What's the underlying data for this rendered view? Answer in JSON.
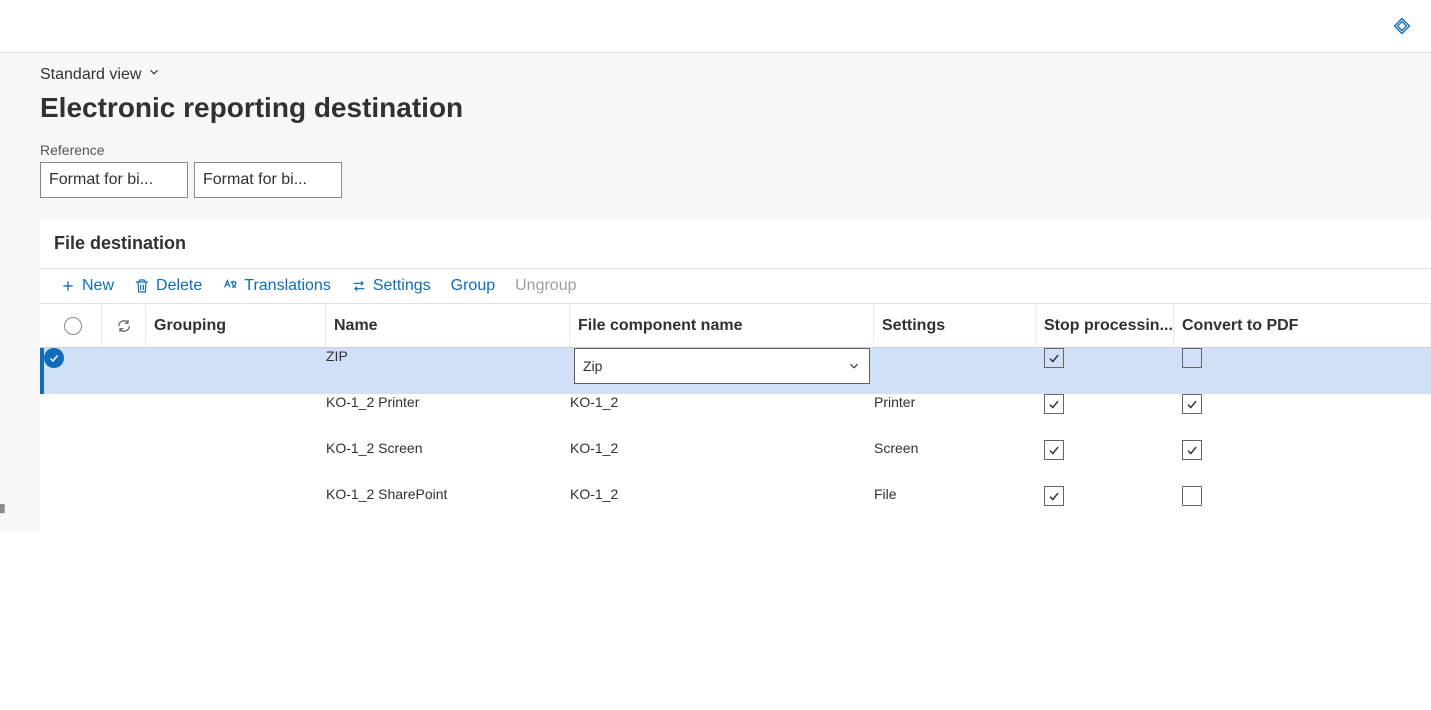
{
  "topbar": {},
  "header": {
    "view_label": "Standard view",
    "page_title": "Electronic reporting destination",
    "reference_label": "Reference",
    "reference_value": "Format for bi...",
    "reference_value2": "Format for bi..."
  },
  "section": {
    "title": "File destination",
    "toolbar": {
      "new": "New",
      "delete": "Delete",
      "translations": "Translations",
      "settings": "Settings",
      "group": "Group",
      "ungroup": "Ungroup"
    }
  },
  "grid": {
    "columns": {
      "grouping": "Grouping",
      "name": "Name",
      "file_component": "File component name",
      "settings": "Settings",
      "stop": "Stop processin...",
      "convert": "Convert to PDF"
    },
    "rows": [
      {
        "selected": true,
        "grouping": "",
        "name": "ZIP",
        "file_component": "Zip",
        "file_component_dropdown": true,
        "settings": "",
        "stop": true,
        "convert": false
      },
      {
        "selected": false,
        "grouping": "",
        "name": "KO-1_2 Printer",
        "file_component": "KO-1_2",
        "file_component_dropdown": false,
        "settings": "Printer",
        "stop": true,
        "convert": true
      },
      {
        "selected": false,
        "grouping": "",
        "name": "KO-1_2 Screen",
        "file_component": "KO-1_2",
        "file_component_dropdown": false,
        "settings": "Screen",
        "stop": true,
        "convert": true
      },
      {
        "selected": false,
        "grouping": "",
        "name": "KO-1_2 SharePoint",
        "file_component": "KO-1_2",
        "file_component_dropdown": false,
        "settings": "File",
        "stop": true,
        "convert": false
      }
    ]
  }
}
